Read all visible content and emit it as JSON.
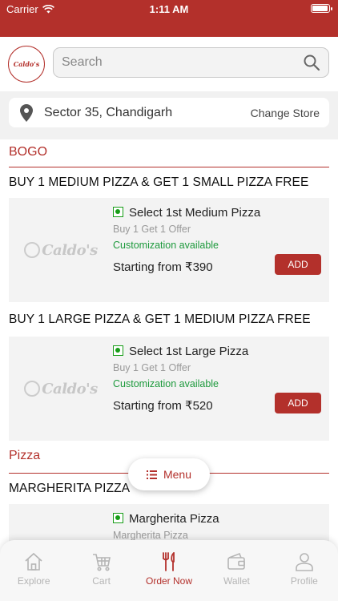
{
  "status_bar": {
    "carrier": "Carrier",
    "time": "1:11 AM",
    "battery_level": 0.95
  },
  "header": {
    "logo_text": "Caldo's",
    "search": {
      "placeholder": "Search",
      "value": ""
    }
  },
  "store": {
    "location": "Sector 35, Chandigarh",
    "change_label": "Change Store"
  },
  "sections": [
    {
      "title": "BOGO",
      "categories": [
        {
          "title": "BUY 1 MEDIUM PIZZA & GET 1 SMALL PIZZA FREE",
          "item": {
            "name": "Select 1st Medium Pizza",
            "desc": "Buy 1 Get 1 Offer",
            "custom": "Customization available",
            "price": "Starting from ₹390",
            "add_label": "ADD"
          }
        },
        {
          "title": "BUY 1 LARGE PIZZA & GET 1 MEDIUM PIZZA FREE",
          "item": {
            "name": "Select 1st Large Pizza",
            "desc": "Buy 1 Get 1 Offer",
            "custom": "Customization available",
            "price": "Starting from ₹520",
            "add_label": "ADD"
          }
        }
      ]
    },
    {
      "title": "Pizza",
      "categories": [
        {
          "title": "MARGHERITA PIZZA",
          "item": {
            "name": "Margherita Pizza",
            "desc": "Margherita Pizza"
          }
        }
      ]
    }
  ],
  "thumb_logo_text": "Caldo's",
  "menu_button": {
    "label": "Menu"
  },
  "tabs": [
    {
      "label": "Explore",
      "icon": "home-icon",
      "active": false
    },
    {
      "label": "Cart",
      "icon": "cart-icon",
      "active": false
    },
    {
      "label": "Order Now",
      "icon": "fork-knife-icon",
      "active": true
    },
    {
      "label": "Wallet",
      "icon": "wallet-icon",
      "active": false
    },
    {
      "label": "Profile",
      "icon": "person-icon",
      "active": false
    }
  ],
  "colors": {
    "brand": "#b3302b",
    "veg": "#179d17",
    "custom_text": "#1e9a3d"
  }
}
